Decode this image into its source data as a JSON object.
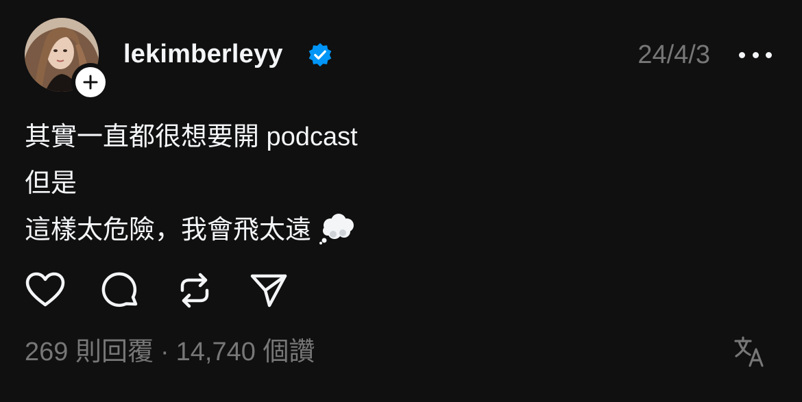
{
  "post": {
    "username": "lekimberleyy",
    "verified": true,
    "timestamp": "24/4/3",
    "lines": [
      "其實一直都很想要開 podcast",
      "但是",
      "這樣太危險，我會飛太遠"
    ],
    "emoji": "thought-balloon-icon"
  },
  "stats": {
    "replies": "269 則回覆",
    "separator": "·",
    "likes": "14,740 個讚"
  },
  "icons": {
    "like": "heart-icon",
    "reply": "comment-icon",
    "repost": "repost-icon",
    "share": "send-icon",
    "translate": "translate-icon",
    "more": "more-icon",
    "follow": "plus-icon",
    "verified": "verified-badge-icon"
  },
  "colors": {
    "background": "#101010",
    "text": "#f3f5f7",
    "muted": "#777777",
    "verified": "#0095f6"
  }
}
